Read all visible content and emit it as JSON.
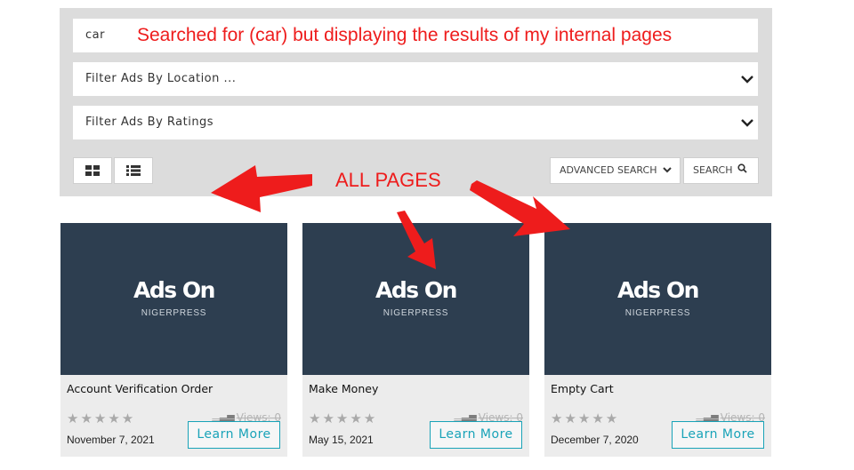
{
  "search": {
    "value": "car",
    "annotation": "Searched for (car) but displaying the results of my internal pages"
  },
  "filters": {
    "location_placeholder": "Filter Ads By Location ...",
    "ratings_placeholder": "Filter Ads By Ratings"
  },
  "toolbar": {
    "advanced_search_label": "ADVANCED SEARCH",
    "search_label": "SEARCH"
  },
  "annotation_all_pages": "ALL PAGES",
  "cards": [
    {
      "brand": "Ads On",
      "sub": "NIGERPRESS",
      "title": "Account Verification Order",
      "stars": "★★★★★",
      "views": "Views: 0",
      "date": "November 7, 2021",
      "cta": "Learn More"
    },
    {
      "brand": "Ads On",
      "sub": "NIGERPRESS",
      "title": "Make Money",
      "stars": "★★★★★",
      "views": "Views: 0",
      "date": "May 15, 2021",
      "cta": "Learn More"
    },
    {
      "brand": "Ads On",
      "sub": "NIGERPRESS",
      "title": "Empty Cart",
      "stars": "★★★★★",
      "views": "Views: 0",
      "date": "December 7, 2020",
      "cta": "Learn More"
    }
  ],
  "colors": {
    "accent": "#19a3b8",
    "annotation": "#ee1c1c",
    "card_image": "#2d3e50"
  }
}
